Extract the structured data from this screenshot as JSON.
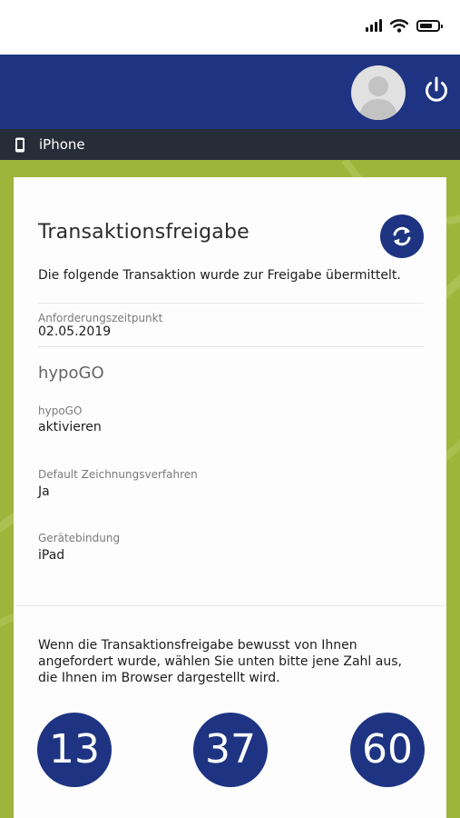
{
  "colors": {
    "brand_blue": "#1e3482",
    "device_bar": "#262d38",
    "background_green": "#9fb43a",
    "card": "#fdfdfd"
  },
  "status_bar": {
    "icons": [
      "signal-icon",
      "wifi-icon",
      "battery-icon"
    ]
  },
  "header": {
    "icons": [
      "avatar",
      "power-icon"
    ]
  },
  "device": {
    "icon": "phone-icon",
    "label": "iPhone"
  },
  "card": {
    "title": "Transaktionsfreigabe",
    "refresh_icon": "refresh-icon",
    "intro": "Die folgende Transaktion wurde zur Freigabe übermittelt.",
    "request_time": {
      "label": "Anforderungszeitpunkt",
      "value": "02.05.2019"
    },
    "section_title": "hypoGO",
    "fields": [
      {
        "label": "hypoGO",
        "value": "aktivieren"
      },
      {
        "label": "Default Zeichnungsverfahren",
        "value": "Ja"
      },
      {
        "label": "Gerätebindung",
        "value": "iPad"
      }
    ],
    "instruction": "Wenn die Transaktionsfreigabe bewusst von Ihnen angefordert wurde, wählen Sie unten bitte jene Zahl aus, die Ihnen im Browser dargestellt wird.",
    "numbers": [
      "13",
      "37",
      "60"
    ]
  }
}
